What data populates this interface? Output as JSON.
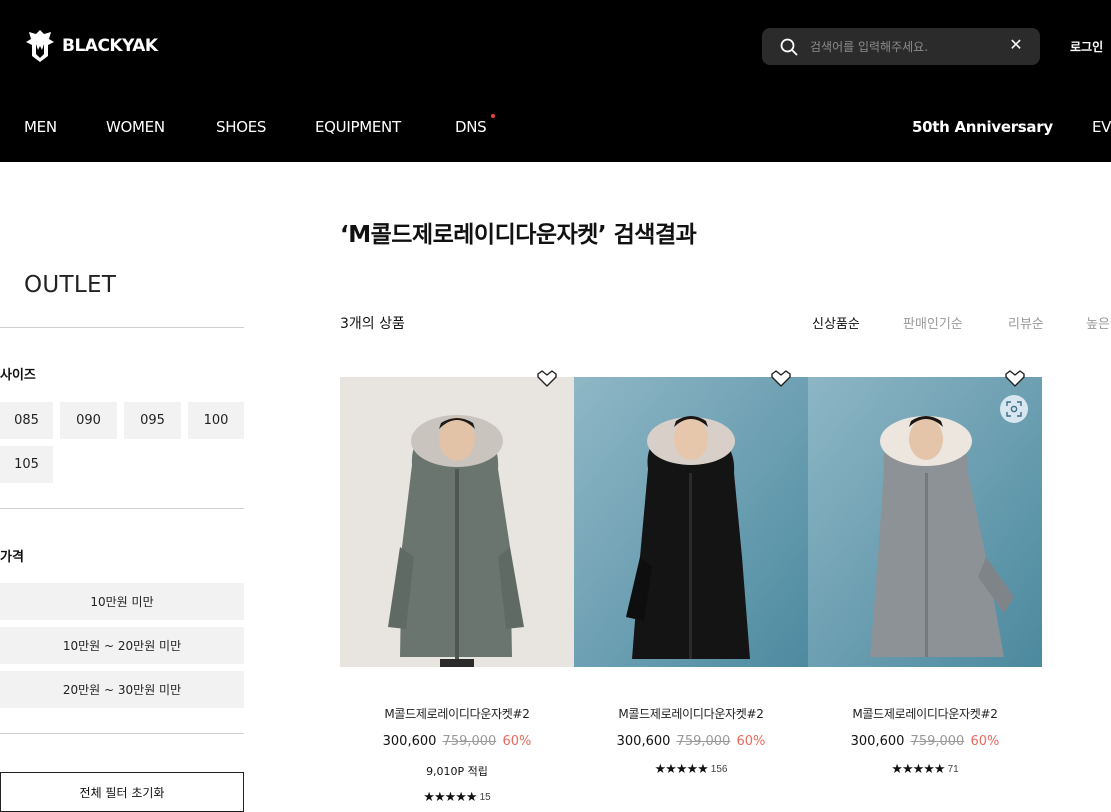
{
  "header": {
    "logo_text": "BLACKYAK",
    "search_placeholder": "검색어를 입력해주세요.",
    "close_label": "✕",
    "login_label": "로그인",
    "nav": [
      "MEN",
      "WOMEN",
      "SHOES",
      "EQUIPMENT",
      "DNS",
      "50th Anniversary",
      "EV"
    ]
  },
  "sidebar": {
    "title": "OUTLET",
    "size_label": "사이즈",
    "sizes": [
      "085",
      "090",
      "095",
      "100",
      "105"
    ],
    "price_label": "가격",
    "price_ranges": [
      "10만원 미만",
      "10만원 ~ 20만원 미만",
      "20만원 ~ 30만원 미만"
    ],
    "reset_label": "전체 필터 초기화"
  },
  "main": {
    "result_title": "‘M콜드제로레이디다운자켓’ 검색결과",
    "count": "3개의 상품",
    "sort": [
      "신상품순",
      "판매인기순",
      "리뷰순",
      "높은"
    ],
    "products": [
      {
        "name": "M콜드제로레이디다운자켓#2",
        "price": "300,600",
        "original": "759,000",
        "discount": "60%",
        "points": "9,010P 적립",
        "stars": "★★★★★",
        "reviews": "15"
      },
      {
        "name": "M콜드제로레이디다운자켓#2",
        "price": "300,600",
        "original": "759,000",
        "discount": "60%",
        "points": "",
        "stars": "★★★★★",
        "reviews": "156"
      },
      {
        "name": "M콜드제로레이디다운자켓#2",
        "price": "300,600",
        "original": "759,000",
        "discount": "60%",
        "points": "",
        "stars": "★★★★★",
        "reviews": "71"
      }
    ]
  },
  "colors": {
    "header_bg": "#000000",
    "discount": "#e96a5f",
    "nav_dot": "#e8443a",
    "chip_bg": "#f2f2f2"
  }
}
